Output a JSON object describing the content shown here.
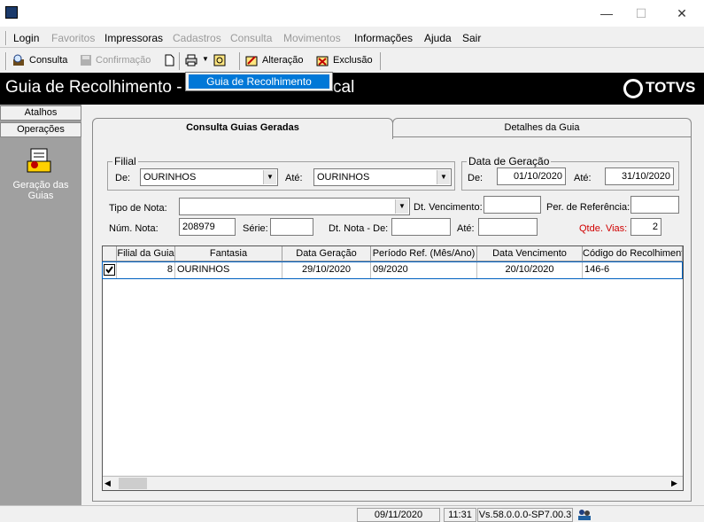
{
  "window": {
    "minimize": "—",
    "maximize": "☐",
    "close": "✕"
  },
  "menu": {
    "items": [
      "Login",
      "Favoritos",
      "Impressoras",
      "Cadastros",
      "Consulta",
      "Movimentos",
      "Informações",
      "Ajuda",
      "Sair"
    ]
  },
  "toolbar": {
    "consulta": "Consulta",
    "confirmacao": "Confirmação",
    "alteracao": "Alteração",
    "exclusao": "Exclusão"
  },
  "banner": {
    "title": "Guia de Recolhimento -",
    "title_tail": "cal",
    "brand": "TOTVS"
  },
  "dropdown": {
    "item": "Guia de Recolhimento"
  },
  "sidebar": {
    "atalhos": "Atalhos",
    "operacoes": "Operações",
    "geracao_label": "Geração das Guias"
  },
  "tabs": {
    "consulta": "Consulta Guias Geradas",
    "detalhes": "Detalhes da Guia"
  },
  "filial": {
    "legend": "Filial",
    "de_label": "De:",
    "de_value": "OURINHOS",
    "ate_label": "Até:",
    "ate_value": "OURINHOS"
  },
  "data_geracao": {
    "legend": "Data de Geração",
    "de_label": "De:",
    "de_value": "01/10/2020",
    "ate_label": "Até:",
    "ate_value": "31/10/2020"
  },
  "filters": {
    "tipo_nota_label": "Tipo de Nota:",
    "tipo_nota_value": "",
    "dt_vencimento_label": "Dt. Vencimento:",
    "dt_vencimento_value": "",
    "per_referencia_label": "Per. de Referência:",
    "per_referencia_value": "",
    "num_nota_label": "Núm. Nota:",
    "num_nota_value": "208979",
    "serie_label": "Série:",
    "serie_value": "",
    "dt_nota_de_label": "Dt. Nota - De:",
    "dt_nota_de_value": "",
    "dt_nota_ate_label": "Até:",
    "dt_nota_ate_value": "",
    "qtde_vias_label": "Qtde. Vias:",
    "qtde_vias_value": "2",
    "qtde_vias_color": "#d00000"
  },
  "grid": {
    "columns": [
      "Filial da Guia",
      "Fantasia",
      "Data Geração",
      "Período Ref. (Mês/Ano)",
      "Data Vencimento",
      "Código do Recolhiment"
    ],
    "rows": [
      {
        "checked": true,
        "filial": "8",
        "fantasia": "OURINHOS",
        "data_geracao": "29/10/2020",
        "periodo_ref": "09/2020",
        "data_vencimento": "20/10/2020",
        "codigo": "146-6"
      }
    ]
  },
  "status": {
    "date": "09/11/2020",
    "time": "11:31",
    "version": "Vs.58.0.0.0-SP7.00.3"
  },
  "colors": {
    "accent": "#0078d7",
    "banner": "#000000"
  }
}
